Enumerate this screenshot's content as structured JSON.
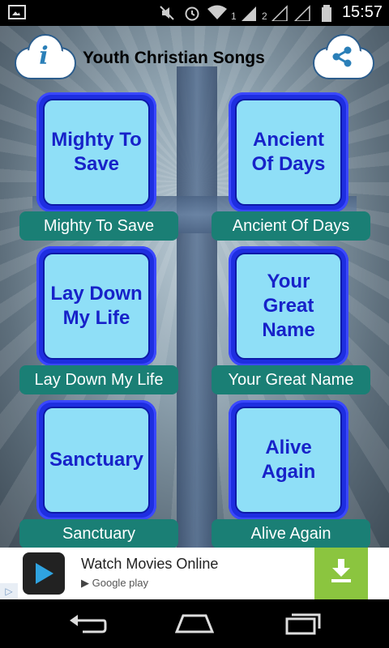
{
  "status": {
    "time": "15:57",
    "sim1": "1",
    "sim2": "2"
  },
  "header": {
    "title": "Youth Christian Songs",
    "info_glyph": "i",
    "info_icon": "info-cloud-icon",
    "share_icon": "share-cloud-icon"
  },
  "songs": [
    {
      "tile_text": "Mighty To Save",
      "label": "Mighty To Save"
    },
    {
      "tile_text": "Ancient Of Days",
      "label": "Ancient Of Days"
    },
    {
      "tile_text": "Lay Down My Life",
      "label": "Lay Down My Life"
    },
    {
      "tile_text": "Your Great Name",
      "label": "Your Great Name"
    },
    {
      "tile_text": "Sanctuary",
      "label": "Sanctuary"
    },
    {
      "tile_text": "Alive Again",
      "label": "Alive Again"
    }
  ],
  "ad": {
    "title": "Watch Movies Online",
    "store": "Google play",
    "download_icon": "download-icon"
  },
  "colors": {
    "tile_outer": "#1e2ee0",
    "tile_inner": "#8fdff7",
    "tile_text": "#1722c9",
    "label_bg": "#1a7f75",
    "download_bg": "#8bc53f"
  }
}
